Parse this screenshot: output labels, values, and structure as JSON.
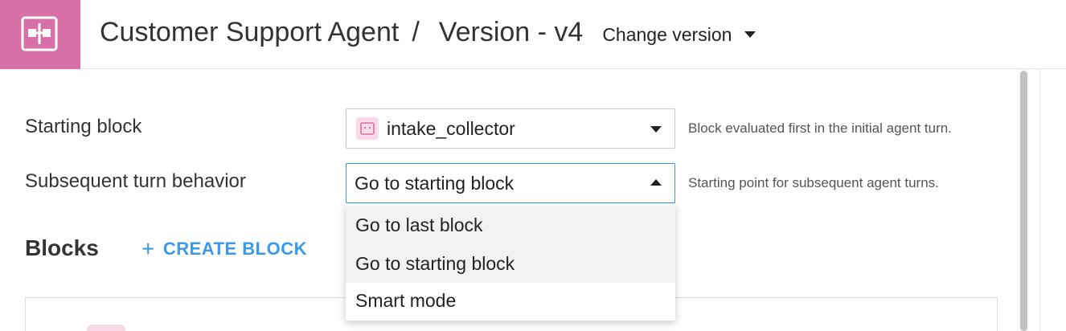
{
  "header": {
    "app_icon": "flow-blocks-icon",
    "title": "Customer Support Agent",
    "separator": "/",
    "version": "Version - v4",
    "change_version_label": "Change version"
  },
  "settings": {
    "starting_block": {
      "label": "Starting block",
      "value": "intake_collector",
      "value_icon": "block-icon",
      "help": "Block evaluated first in the initial agent turn."
    },
    "subsequent_turn": {
      "label": "Subsequent turn behavior",
      "value": "Go to starting block",
      "help": "Starting point for subsequent agent turns.",
      "options": [
        "Go to last block",
        "Go to starting block",
        "Smart mode"
      ]
    }
  },
  "blocks": {
    "title": "Blocks",
    "create_label": "CREATE BLOCK"
  },
  "colors": {
    "brand": "#d86fa6",
    "accent": "#3a9ae8",
    "focus_border": "#3a9ae8"
  }
}
